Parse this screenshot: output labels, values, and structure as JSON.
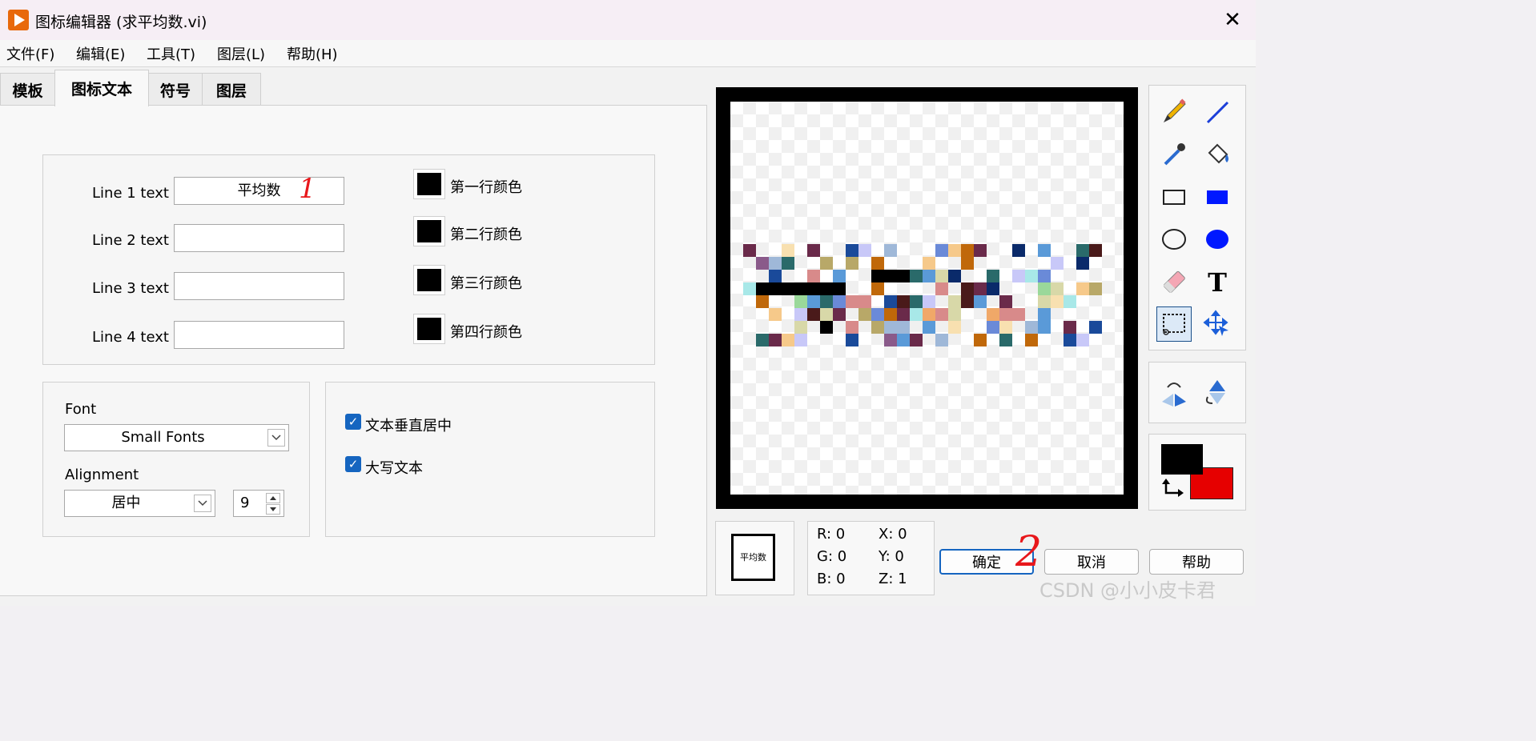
{
  "window": {
    "title": "图标编辑器 (求平均数.vi)",
    "close_glyph": "✕"
  },
  "menu": [
    {
      "label": "文件(F)"
    },
    {
      "label": "编辑(E)"
    },
    {
      "label": "工具(T)"
    },
    {
      "label": "图层(L)"
    },
    {
      "label": "帮助(H)"
    }
  ],
  "tabs": [
    {
      "label": "模板",
      "active": false
    },
    {
      "label": "图标文本",
      "active": true
    },
    {
      "label": "符号",
      "active": false
    },
    {
      "label": "图层",
      "active": false
    }
  ],
  "text_lines": [
    {
      "label": "Line 1 text",
      "value": "平均数",
      "color_label": "第一行颜色"
    },
    {
      "label": "Line 2 text",
      "value": "",
      "color_label": "第二行颜色"
    },
    {
      "label": "Line 3 text",
      "value": "",
      "color_label": "第三行颜色"
    },
    {
      "label": "Line 4 text",
      "value": "",
      "color_label": "第四行颜色"
    }
  ],
  "font": {
    "label": "Font",
    "value": "Small Fonts"
  },
  "alignment": {
    "label": "Alignment",
    "value": "居中",
    "size": "9"
  },
  "options": [
    {
      "label": "文本垂直居中",
      "checked": true
    },
    {
      "label": "大写文本",
      "checked": true
    }
  ],
  "preview": {
    "icon_text": "平均数"
  },
  "readout": {
    "r": "R: 0",
    "g": "G: 0",
    "b": "B: 0",
    "x": "X: 0",
    "y": "Y: 0",
    "z": "Z: 1"
  },
  "buttons": {
    "ok": "确定",
    "cancel": "取消",
    "help": "帮助"
  },
  "colors": {
    "foreground": "#000000",
    "background": "#e60000",
    "accent": "#1565c0",
    "annotation": "#e8171b"
  },
  "annotations": [
    "1",
    "2"
  ],
  "watermark": "CSDN @小小皮卡君",
  "tool_icons": [
    "pencil-icon",
    "line-icon",
    "dropper-icon",
    "fill-bucket-icon",
    "rectangle-icon",
    "filled-rectangle-icon",
    "ellipse-icon",
    "filled-ellipse-icon",
    "eraser-icon",
    "text-tool-icon",
    "selection-icon",
    "move-icon",
    "flip-horizontal-icon",
    "flip-vertical-icon"
  ]
}
